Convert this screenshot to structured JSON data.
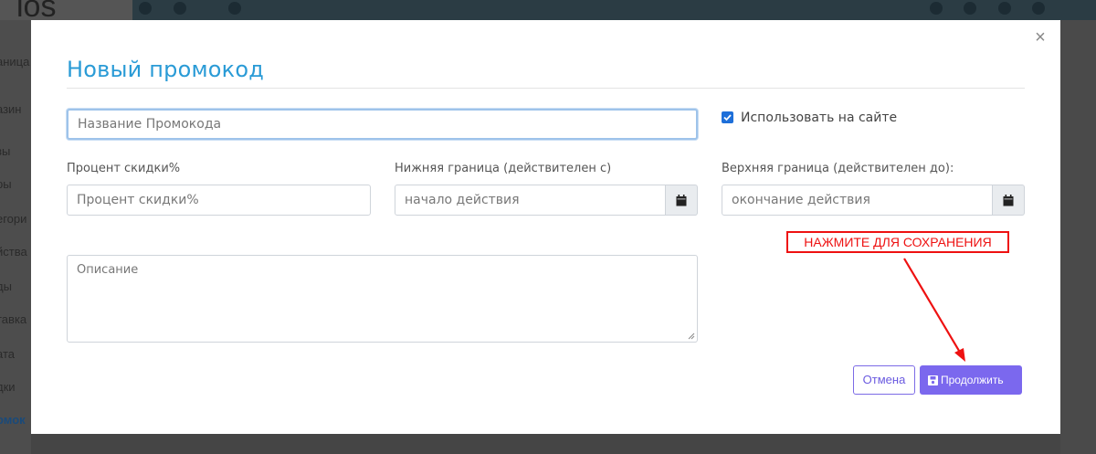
{
  "background": {
    "logo_text": "los",
    "sidebar_items": [
      "аница",
      "азин",
      "зы",
      "ры",
      "егори",
      "йства",
      "ды",
      "тавка",
      "ата",
      "дки",
      "омок"
    ]
  },
  "modal": {
    "title": "Новый промокод",
    "close_symbol": "×",
    "name_input": {
      "placeholder": "Название Промокода"
    },
    "use_on_site": {
      "label": "Использовать на сайте",
      "checked": true
    },
    "discount": {
      "label": "Процент скидки%",
      "placeholder": "Процент скидки%"
    },
    "lower_bound": {
      "label": "Нижняя граница (действителен с)",
      "placeholder": "начало действия"
    },
    "upper_bound": {
      "label": "Верхняя граница (действителен до):",
      "placeholder": "окончание действия"
    },
    "description": {
      "placeholder": "Описание"
    },
    "annotation": "НАЖМИТЕ ДЛЯ СОХРАНЕНИЯ",
    "buttons": {
      "cancel": "Отмена",
      "continue": "Продолжить"
    }
  },
  "colors": {
    "title": "#2a9bd6",
    "primary_button": "#7b68ee",
    "annotation": "#ee1111",
    "checkbox": "#1e6fd9"
  }
}
